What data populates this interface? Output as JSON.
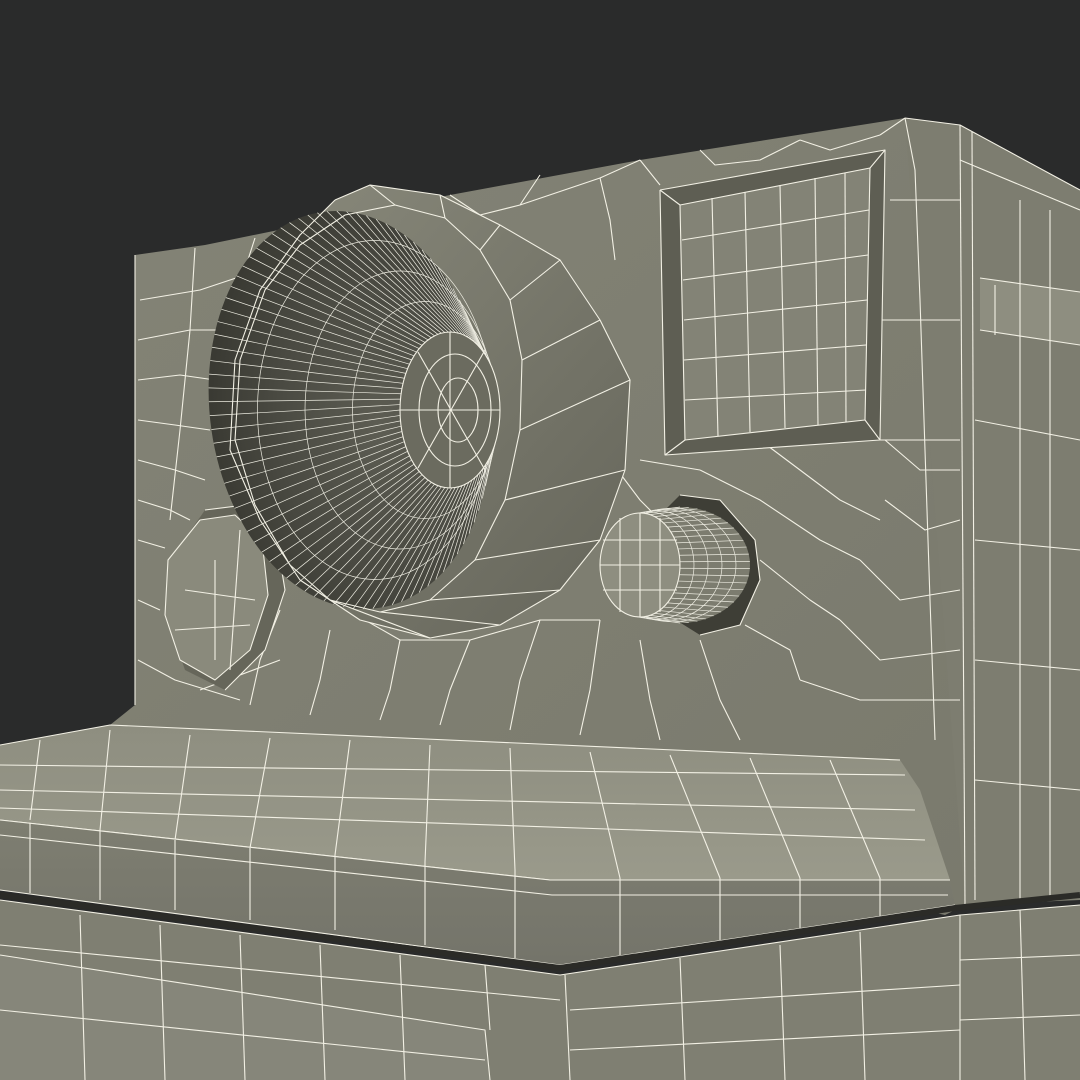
{
  "image": {
    "subject": "",
    "labels": []
  },
  "colors": {
    "background": "#2a2b2b",
    "body_light": "#8b8b7d",
    "body_mid": "#77776a",
    "body_dark": "#5b5b50",
    "shadow": "#3f3f37",
    "wireframe": "#f2f0e4"
  }
}
